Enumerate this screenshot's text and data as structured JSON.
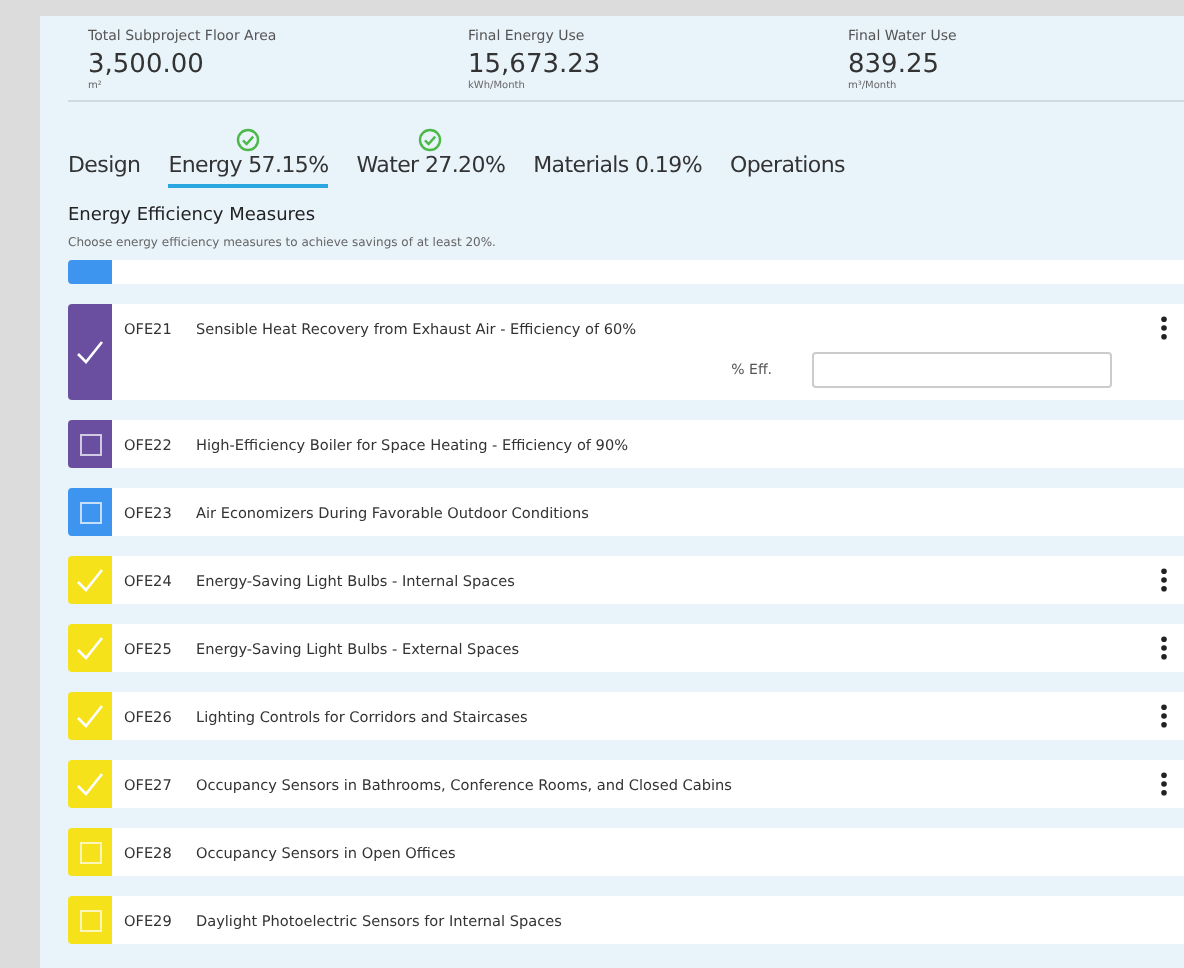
{
  "stats": [
    {
      "label": "Total Subproject Floor Area",
      "value": "3,500.00",
      "unit": "m²"
    },
    {
      "label": "Final Energy Use",
      "value": "15,673.23",
      "unit": "kWh/Month"
    },
    {
      "label": "Final Water Use",
      "value": "839.25",
      "unit": "m³/Month"
    }
  ],
  "tabs": [
    {
      "label": "Design",
      "selected": false,
      "done": false
    },
    {
      "label": "Energy 57.15%",
      "selected": true,
      "done": true
    },
    {
      "label": "Water 27.20%",
      "selected": false,
      "done": true
    },
    {
      "label": "Materials 0.19%",
      "selected": false,
      "done": false
    },
    {
      "label": "Operations",
      "selected": false,
      "done": false
    }
  ],
  "section": {
    "title": "Energy Efficiency Measures",
    "subtitle": "Choose energy efficiency measures to achieve savings of at least 20%."
  },
  "measures": [
    {
      "color": "#3d95f0",
      "partial": true
    },
    {
      "code": "OFE21",
      "name": "Sensible Heat Recovery from Exhaust Air - Efficiency of 60%",
      "color": "#6a4fa0",
      "checked": true,
      "menu": true,
      "field": {
        "label": "% Eff."
      }
    },
    {
      "code": "OFE22",
      "name": "High-Efficiency Boiler for Space Heating - Efficiency of 90%",
      "color": "#6a4fa0",
      "checked": false,
      "menu": false
    },
    {
      "code": "OFE23",
      "name": "Air Economizers During Favorable Outdoor Conditions",
      "color": "#3d95f0",
      "checked": false,
      "menu": false
    },
    {
      "code": "OFE24",
      "name": "Energy-Saving Light Bulbs - Internal Spaces",
      "color": "#f5e21b",
      "checked": true,
      "menu": true
    },
    {
      "code": "OFE25",
      "name": "Energy-Saving Light Bulbs - External Spaces",
      "color": "#f5e21b",
      "checked": true,
      "menu": true
    },
    {
      "code": "OFE26",
      "name": "Lighting Controls for Corridors and Staircases",
      "color": "#f5e21b",
      "checked": true,
      "menu": true
    },
    {
      "code": "OFE27",
      "name": "Occupancy Sensors in Bathrooms, Conference Rooms, and Closed Cabins",
      "color": "#f5e21b",
      "checked": true,
      "menu": true
    },
    {
      "code": "OFE28",
      "name": "Occupancy Sensors in Open Offices",
      "color": "#f5e21b",
      "checked": false,
      "menu": false
    },
    {
      "code": "OFE29",
      "name": "Daylight Photoelectric Sensors for Internal Spaces",
      "color": "#f5e21b",
      "checked": false,
      "menu": false
    }
  ]
}
